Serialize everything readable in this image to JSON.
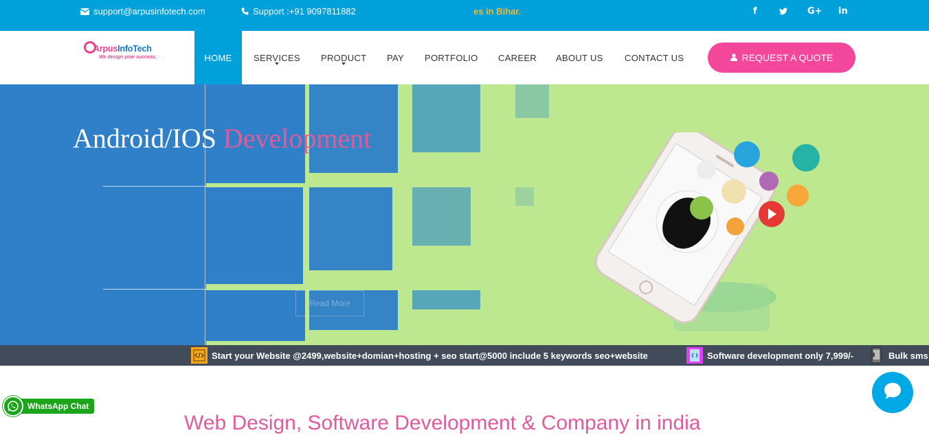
{
  "topbar": {
    "email": "support@arpusinfotech.com",
    "phone": "Support :+91 9097811882",
    "marquee": "es in Bihar.",
    "social": [
      "f",
      "t",
      "G+",
      "in"
    ]
  },
  "nav": {
    "logo_brand_1": "Arpus",
    "logo_brand_2": "InfoTech",
    "logo_tagline": "We design your success.",
    "items": [
      "HOME",
      "SERVICES",
      "PRODUCT",
      "PAY",
      "PORTFOLIO",
      "CAREER",
      "ABOUT US",
      "CONTACT US"
    ],
    "quote_label": "REQUEST A QUOTE"
  },
  "hero": {
    "title_main": "Android/IOS ",
    "title_accent": "Development",
    "hidden_button": "Read More"
  },
  "ticker": {
    "items": [
      "Start your Website @2499,website+domian+hosting + seo start@5000 include 5 keywords seo+website",
      "Software development only 7,999/-",
      "Bulk sms"
    ]
  },
  "whatsapp": {
    "label": "WhatsApp Chat"
  },
  "section": {
    "title": "Web Design, Software Development & Company in india"
  },
  "colors": {
    "primary": "#00a0db",
    "accent": "#f2479a",
    "hero_bg": "#bde890",
    "ticker_bg": "#414b5a"
  }
}
